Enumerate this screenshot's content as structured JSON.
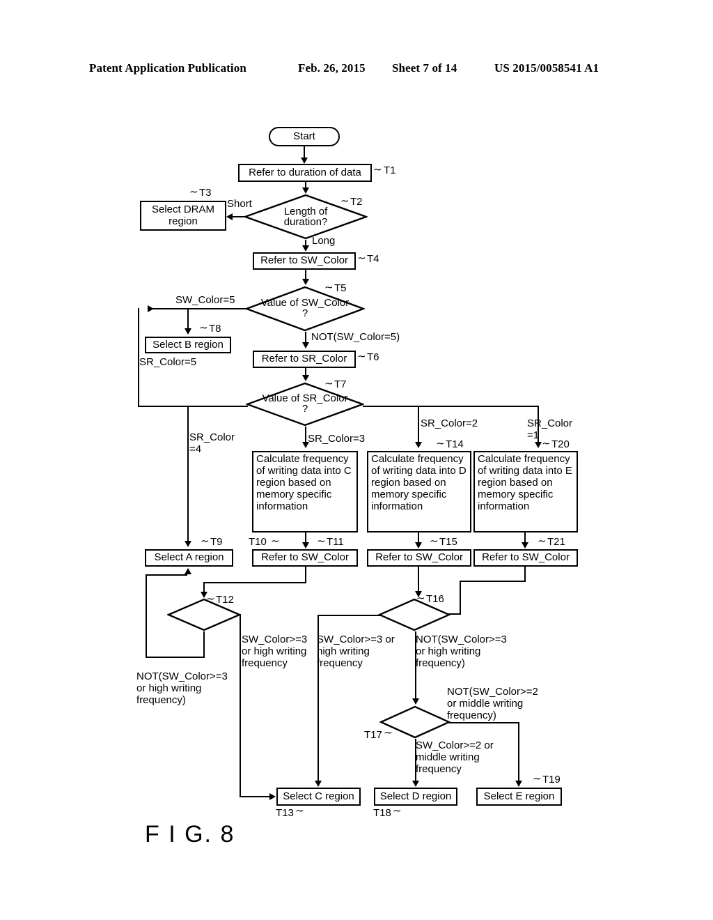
{
  "header": {
    "publication": "Patent Application Publication",
    "date": "Feb. 26, 2015",
    "sheet": "Sheet 7 of 14",
    "number": "US 2015/0058541 A1"
  },
  "figure": {
    "label": "F I G. 8"
  },
  "chart_data": {
    "type": "diagram",
    "title": "F I G. 8",
    "nodes": [
      {
        "id": "start",
        "step": "",
        "shape": "terminator",
        "text": "Start"
      },
      {
        "id": "T1",
        "step": "T1",
        "shape": "process",
        "text": "Refer to duration of data"
      },
      {
        "id": "T2",
        "step": "T2",
        "shape": "decision",
        "text": "Length of duration?"
      },
      {
        "id": "T3",
        "step": "T3",
        "shape": "process",
        "text": "Select DRAM region"
      },
      {
        "id": "T4",
        "step": "T4",
        "shape": "process",
        "text": "Refer to SW_Color"
      },
      {
        "id": "T5",
        "step": "T5",
        "shape": "decision",
        "text": "Value of SW_Color ?"
      },
      {
        "id": "T6",
        "step": "T6",
        "shape": "process",
        "text": "Refer to SR_Color"
      },
      {
        "id": "T7",
        "step": "T7",
        "shape": "decision",
        "text": "Value of SR_Color ?"
      },
      {
        "id": "T8",
        "step": "T8",
        "shape": "process",
        "text": "Select B region"
      },
      {
        "id": "T9",
        "step": "T9",
        "shape": "process",
        "text": "Select A region"
      },
      {
        "id": "T10",
        "step": "T10",
        "shape": "process",
        "text": "Calculate frequency of writing data into C region based on memory specific information"
      },
      {
        "id": "T11",
        "step": "T11",
        "shape": "process",
        "text": "Refer to SW_Color"
      },
      {
        "id": "T12",
        "step": "T12",
        "shape": "decision",
        "text": ""
      },
      {
        "id": "T13",
        "step": "T13",
        "shape": "process",
        "text": "Select C region"
      },
      {
        "id": "T14",
        "step": "T14",
        "shape": "process",
        "text": "Calculate frequency of writing data into D region based on memory specific information"
      },
      {
        "id": "T15",
        "step": "T15",
        "shape": "process",
        "text": "Refer to SW_Color"
      },
      {
        "id": "T16",
        "step": "T16",
        "shape": "decision",
        "text": ""
      },
      {
        "id": "T17",
        "step": "T17",
        "shape": "decision",
        "text": ""
      },
      {
        "id": "T18",
        "step": "T18",
        "shape": "process",
        "text": "Select D region"
      },
      {
        "id": "T19",
        "step": "T19",
        "shape": "process",
        "text": "Select E region"
      },
      {
        "id": "T20",
        "step": "T20",
        "shape": "process",
        "text": "Calculate frequency of writing data into E region based on memory specific information"
      },
      {
        "id": "T21",
        "step": "T21",
        "shape": "process",
        "text": "Refer to SW_Color"
      }
    ],
    "edge_labels": [
      "Short",
      "Long",
      "SW_Color=5",
      "NOT(SW_Color=5)",
      "SR_Color=5",
      "SR_Color=4",
      "SR_Color=3",
      "SR_Color=2",
      "SR_Color=1",
      "SW_Color>=3 or high writing frequency",
      "NOT(SW_Color>=3 or high writing frequency)",
      "SW_Color>=2 or middle writing frequency",
      "NOT(SW_Color>=2 or middle writing frequency)"
    ]
  },
  "nodes": {
    "start": {
      "text": "Start"
    },
    "t1": {
      "text": "Refer to duration of data",
      "tag": "T1"
    },
    "t2": {
      "line1": "Length of",
      "line2": "duration?",
      "tag": "T2"
    },
    "t3": {
      "line1": "Select DRAM",
      "line2": "region",
      "tag": "T3"
    },
    "t4": {
      "text": "Refer to SW_Color",
      "tag": "T4"
    },
    "t5": {
      "line1": "Value of SW_Color",
      "line2": "?",
      "tag": "T5"
    },
    "t6": {
      "text": "Refer to SR_Color",
      "tag": "T6"
    },
    "t7": {
      "line1": "Value of SR_Color",
      "line2": "?",
      "tag": "T7"
    },
    "t8": {
      "text": "Select B region",
      "tag": "T8"
    },
    "t9": {
      "text": "Select A region",
      "tag": "T9"
    },
    "t10": {
      "text": "Calculate\nfrequency of\nwriting data into C\nregion based on\nmemory specific\ninformation",
      "tag": "T10"
    },
    "t11": {
      "text": "Refer to SW_Color",
      "tag": "T11"
    },
    "t12": {
      "tag": "T12"
    },
    "t13": {
      "text": "Select C region",
      "tag": "T13"
    },
    "t14": {
      "text": "Calculate\nfrequency of\nwriting data into D\nregion based on\nmemory specific\ninformation",
      "tag": "T14"
    },
    "t15": {
      "text": "Refer to SW_Color",
      "tag": "T15"
    },
    "t16": {
      "tag": "T16"
    },
    "t17": {
      "tag": "T17"
    },
    "t18": {
      "text": "Select D region",
      "tag": "T18"
    },
    "t19": {
      "text": "Select E region",
      "tag": "T19"
    },
    "t20": {
      "text": "Calculate\nfrequency of\nwriting data into E\nregion based on\nmemory specific\ninformation",
      "tag": "T20"
    },
    "t21": {
      "text": "Refer to SW_Color",
      "tag": "T21"
    }
  },
  "edges": {
    "short": "Short",
    "long": "Long",
    "sw_eq5": "SW_Color=5",
    "not_sw_eq5": "NOT(SW_Color=5)",
    "sr_eq5": "SR_Color=5",
    "sr_eq4": "SR_Color\n=4",
    "sr_eq3": "SR_Color=3",
    "sr_eq2": "SR_Color=2",
    "sr_eq1": "SR_Color\n=1",
    "sw_ge3_a": "SW_Color>=3\nor high writing\nfrequency",
    "sw_ge3_b": "SW_Color>=3 or\nhigh writing\nfrequency",
    "not_sw_ge3_left": "NOT(SW_Color>=3\nor high writing\nfrequency)",
    "not_sw_ge3_right": "NOT(SW_Color>=3\nor high writing\nfrequency)",
    "not_sw_ge2": "NOT(SW_Color>=2\nor middle writing\nfrequency)",
    "sw_ge2": "SW_Color>=2 or\nmiddle writing\nfrequency"
  }
}
